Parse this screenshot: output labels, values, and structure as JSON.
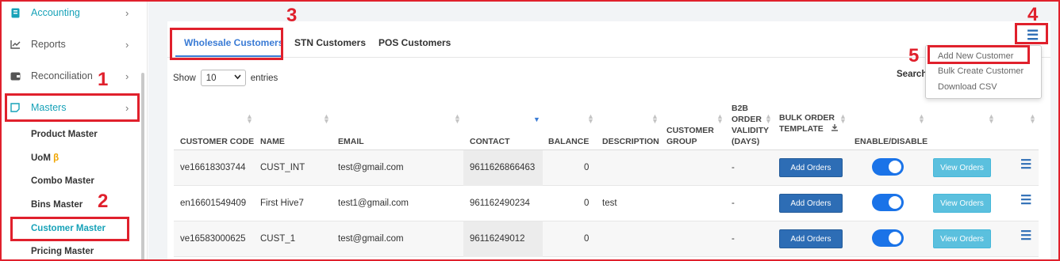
{
  "sidebar": {
    "items": [
      {
        "label": "Accounting",
        "icon": "book-icon",
        "chevron": "›"
      },
      {
        "label": "Reports",
        "icon": "chart-icon",
        "chevron": "›"
      },
      {
        "label": "Reconciliation",
        "icon": "wallet-icon",
        "chevron": "›"
      },
      {
        "label": "Masters",
        "icon": "note-icon",
        "chevron": "›"
      }
    ],
    "subitems": [
      {
        "label": "Product Master"
      },
      {
        "label": "UoM",
        "badge": "β"
      },
      {
        "label": "Combo Master"
      },
      {
        "label": "Bins Master"
      },
      {
        "label": "Customer Master"
      },
      {
        "label": "Pricing Master"
      }
    ]
  },
  "tabs": [
    {
      "label": "Wholesale Customers",
      "active": true
    },
    {
      "label": "STN Customers"
    },
    {
      "label": "POS Customers"
    }
  ],
  "controls": {
    "show_label": "Show",
    "entries_value": "10",
    "entries_label": "entries",
    "search_label": "Search:"
  },
  "menu": {
    "icon": "hamburger-icon",
    "items": [
      "Add New Customer",
      "Bulk Create Customer",
      "Download CSV"
    ]
  },
  "table": {
    "headers": {
      "customer_code": "CUSTOMER CODE",
      "name": "NAME",
      "email": "EMAIL",
      "contact": "CONTACT",
      "balance": "BALANCE",
      "description": "DESCRIPTION",
      "customer_group_1": "CUSTOMER",
      "customer_group_2": "GROUP",
      "b2b_1": "B2B",
      "b2b_2": "ORDER",
      "b2b_3": "VALIDITY",
      "b2b_4": "(DAYS)",
      "bulk_1": "BULK ORDER",
      "bulk_2": "TEMPLATE",
      "enable": "ENABLE/DISABLE"
    },
    "rows": [
      {
        "code": "ve16618303744",
        "name": "CUST_INT",
        "email": "test@gmail.com",
        "contact": "9611626866463",
        "balance": "0",
        "description": "",
        "validity": "-",
        "add_orders": "Add Orders",
        "view_orders": "View Orders"
      },
      {
        "code": "en16601549409",
        "name": "First Hive7",
        "email": "test1@gmail.com",
        "contact": "961162490234",
        "balance": "0",
        "description": "test",
        "validity": "-",
        "add_orders": "Add Orders",
        "view_orders": "View Orders"
      },
      {
        "code": "ve16583000625",
        "name": "CUST_1",
        "email": "test@gmail.com",
        "contact": "96116249012",
        "balance": "0",
        "description": "",
        "validity": "-",
        "add_orders": "Add Orders",
        "view_orders": "View Orders"
      }
    ]
  },
  "annotations": [
    "1",
    "2",
    "3",
    "4",
    "5"
  ],
  "colors": {
    "accent": "#17a2b8",
    "primary": "#2d6db5",
    "annotation": "#e0202c",
    "view_button": "#5bc0de",
    "toggle_on": "#1a73e8"
  }
}
